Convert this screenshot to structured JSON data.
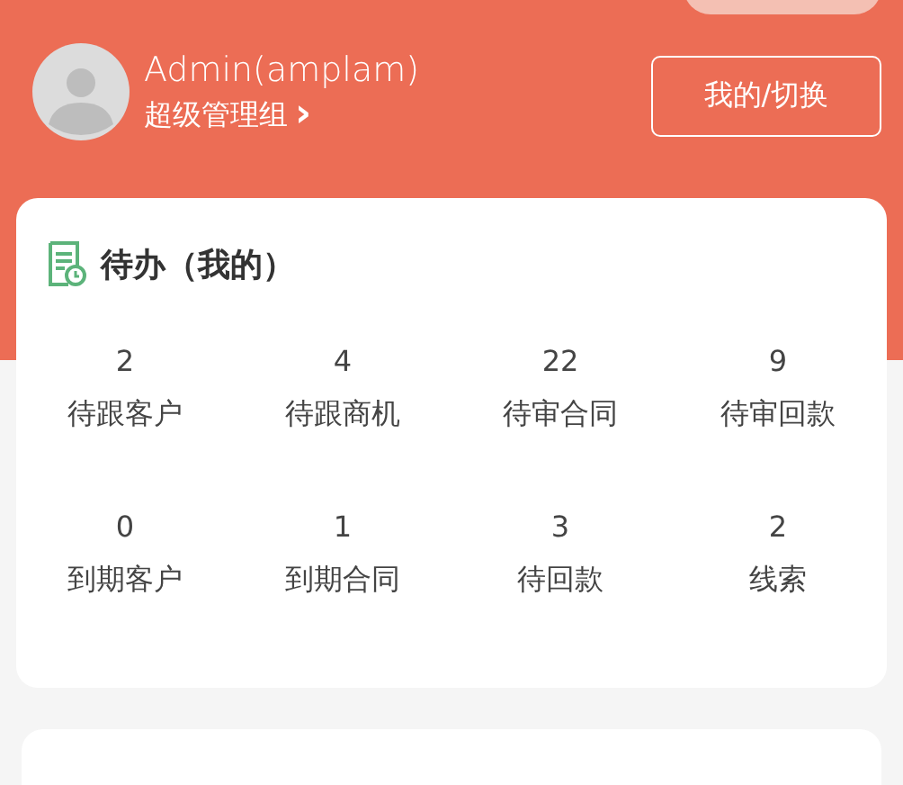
{
  "user": {
    "name": "Admin(amplam)",
    "role": "超级管理组",
    "role_arrow": "›"
  },
  "switch_button": {
    "label": "我的/切换"
  },
  "todo": {
    "title": "待办（我的）",
    "items": [
      {
        "count": "2",
        "label": "待跟客户"
      },
      {
        "count": "4",
        "label": "待跟商机"
      },
      {
        "count": "22",
        "label": "待审合同"
      },
      {
        "count": "9",
        "label": "待审回款"
      },
      {
        "count": "0",
        "label": "到期客户"
      },
      {
        "count": "1",
        "label": "到期合同"
      },
      {
        "count": "3",
        "label": "待回款"
      },
      {
        "count": "2",
        "label": "线索"
      }
    ]
  }
}
